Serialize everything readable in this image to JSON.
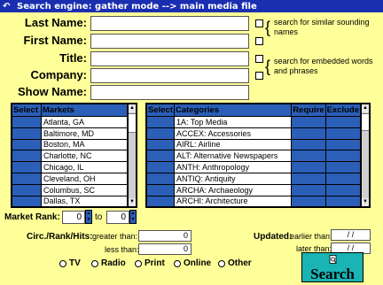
{
  "title": "Search engine: gather mode --> main media file",
  "fields": {
    "last_name": "Last Name:",
    "first_name": "First Name:",
    "title": "Title:",
    "company": "Company:",
    "show_name": "Show Name:"
  },
  "options": {
    "sounding": "search for similar sounding names",
    "embedded": "search for embedded words and phrases"
  },
  "markets": {
    "col_select": "Select",
    "col_markets": "Markets",
    "rows": [
      "Atlanta, GA",
      "Baltimore, MD",
      "Boston, MA",
      "Charlotte, NC",
      "Chicago, IL",
      "Cleveland, OH",
      "Columbus, SC",
      "Dallas, TX"
    ]
  },
  "categories": {
    "col_select": "Select",
    "col_categories": "Categories",
    "col_require": "Require",
    "col_exclude": "Exclude",
    "rows": [
      "1A: Top Media",
      "ACCEX: Accessories",
      "AIRL: Airline",
      "ALT: Alternative Newspapers",
      "ANTH: Anthropology",
      "ANTIQ: Antiquity",
      "ARCHA: Archaeology",
      "ARCHI: Architecture"
    ]
  },
  "market_rank": {
    "label": "Market Rank:",
    "from": "0",
    "to_label": "to",
    "to": "0"
  },
  "circ": {
    "label": "Circ./Rank/Hits:",
    "greater_label": "greater than:",
    "greater_value": "0",
    "less_label": "less than:",
    "less_value": "0"
  },
  "updated": {
    "label": "Updated:",
    "earlier_label": "earlier than:",
    "earlier_value": "/ /",
    "later_label": "later than:",
    "later_value": "/ /"
  },
  "media": [
    "TV",
    "Radio",
    "Print",
    "Online",
    "Other"
  ],
  "search_button": "Search",
  "colors": {
    "background": "#ffff99",
    "titlebar": "#1a2fb0",
    "grid_header": "#2b5fb8",
    "button": "#1ab4b4"
  }
}
